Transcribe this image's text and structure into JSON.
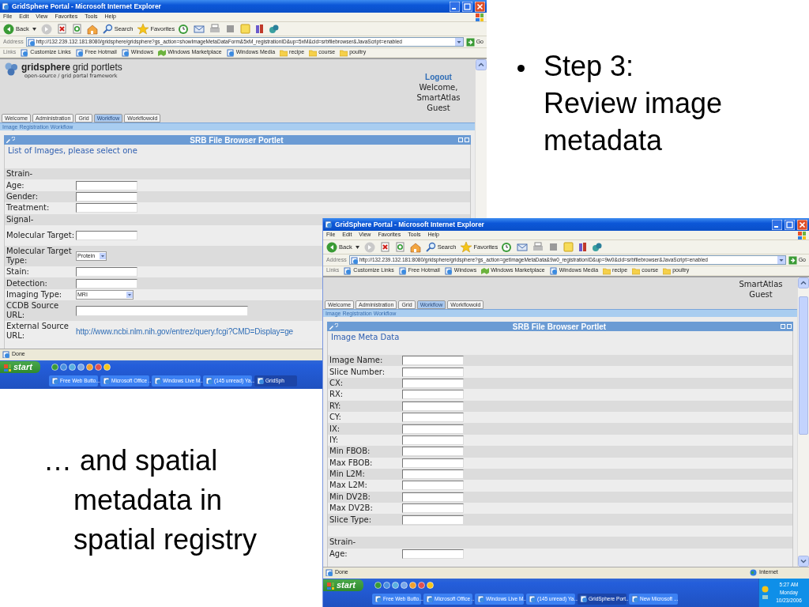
{
  "windows": [
    {
      "title": "GridSphere Portal - Microsoft Internet Explorer",
      "menu": [
        "File",
        "Edit",
        "View",
        "Favorites",
        "Tools",
        "Help"
      ],
      "toolbar": [
        "Back",
        "Search",
        "Favorites"
      ],
      "address_label": "Address",
      "url": "http://132.239.132.181:8080/gridsphere/gridsphere?gs_action=showImageMetaDataForm&5xM_registrationID&up=5xM&cid=srbfilebrowser&JavaScript=enabled",
      "go": "Go",
      "links_label": "Links",
      "links": [
        {
          "label": "Customize Links",
          "kind": "page"
        },
        {
          "label": "Free Hotmail",
          "kind": "page"
        },
        {
          "label": "Windows",
          "kind": "page"
        },
        {
          "label": "Windows Marketplace",
          "kind": "market"
        },
        {
          "label": "Windows Media",
          "kind": "page"
        },
        {
          "label": "recipe",
          "kind": "folder"
        },
        {
          "label": "course",
          "kind": "folder"
        },
        {
          "label": "poultry",
          "kind": "folder"
        }
      ],
      "header": {
        "logo_title": "gridsphere",
        "logo_rest": "grid portlets",
        "logo_subtitle": "open-source / grid portal framework",
        "logout": "Logout",
        "welcome": [
          "Welcome,",
          "SmartAtlas",
          "Guest"
        ]
      },
      "tabs": [
        {
          "label": "Welcome",
          "selected": false
        },
        {
          "label": "Administration",
          "selected": false
        },
        {
          "label": "Grid",
          "selected": false
        },
        {
          "label": "Workflow",
          "selected": true
        },
        {
          "label": "Workflowold",
          "selected": false
        }
      ],
      "breadcrumb": "Image Registration Workflow",
      "portlet_title": "SRB File Browser Portlet",
      "section_title": "List of Images, please select one",
      "rows": [
        {
          "kind": "section",
          "label": "Strain-"
        },
        {
          "kind": "text",
          "label": "Age:"
        },
        {
          "kind": "text",
          "label": "Gender:"
        },
        {
          "kind": "text",
          "label": "Treatment:"
        },
        {
          "kind": "section",
          "label": "Signal-"
        },
        {
          "kind": "text",
          "label": "Molecular Target:"
        },
        {
          "kind": "select",
          "label": "Molecular Target Type:",
          "value": "Protein"
        },
        {
          "kind": "text",
          "label": "Stain:"
        },
        {
          "kind": "text",
          "label": "Detection:"
        },
        {
          "kind": "select",
          "label": "Imaging Type:",
          "value": "MRI"
        },
        {
          "kind": "wide",
          "label": "CCDB Source URL:"
        },
        {
          "kind": "link",
          "label": "External Source URL:",
          "value": "http://www.ncbi.nlm.nih.gov/entrez/query.fcgi?CMD=Display=ge"
        }
      ],
      "status": "Done",
      "start": "start",
      "tasks": [
        {
          "label": "Free Web Butto...",
          "selected": false
        },
        {
          "label": "Microsoft Office ...",
          "selected": false
        },
        {
          "label": "Windows Live M...",
          "selected": false
        },
        {
          "label": "(145 unread) Ya...",
          "selected": false
        },
        {
          "label": "GridSph",
          "selected": true
        }
      ]
    },
    {
      "title": "GridSphere Portal - Microsoft Internet Explorer",
      "menu": [
        "File",
        "Edit",
        "View",
        "Favorites",
        "Tools",
        "Help"
      ],
      "toolbar": [
        "Back",
        "Search",
        "Favorites"
      ],
      "address_label": "Address",
      "url": "http://132.239.132.181:8080/gridsphere/gridsphere?gs_action=getImageMetaData&9w0_registrationID&up=9w0&cid=srbfilebrowser&JavaScript=enabled",
      "go": "Go",
      "links_label": "Links",
      "links": [
        {
          "label": "Customize Links",
          "kind": "page"
        },
        {
          "label": "Free Hotmail",
          "kind": "page"
        },
        {
          "label": "Windows",
          "kind": "page"
        },
        {
          "label": "Windows Marketplace",
          "kind": "market"
        },
        {
          "label": "Windows Media",
          "kind": "page"
        },
        {
          "label": "recipe",
          "kind": "folder"
        },
        {
          "label": "course",
          "kind": "folder"
        },
        {
          "label": "poultry",
          "kind": "folder"
        }
      ],
      "header": {
        "welcome": [
          "SmartAtlas",
          "Guest"
        ]
      },
      "tabs": [
        {
          "label": "Welcome",
          "selected": false
        },
        {
          "label": "Administration",
          "selected": false
        },
        {
          "label": "Grid",
          "selected": false
        },
        {
          "label": "Workflow",
          "selected": true
        },
        {
          "label": "Workflowold",
          "selected": false
        }
      ],
      "breadcrumb": "Image Registration Workflow",
      "portlet_title": "SRB File Browser Portlet",
      "section_title": "Image Meta Data",
      "rows": [
        {
          "kind": "text",
          "label": "Image Name:"
        },
        {
          "kind": "text",
          "label": "Slice Number:"
        },
        {
          "kind": "text",
          "label": "CX:"
        },
        {
          "kind": "text",
          "label": "RX:"
        },
        {
          "kind": "text",
          "label": "RY:"
        },
        {
          "kind": "text",
          "label": "CY:"
        },
        {
          "kind": "text",
          "label": "IX:"
        },
        {
          "kind": "text",
          "label": "IY:"
        },
        {
          "kind": "text",
          "label": "Min FBOB:"
        },
        {
          "kind": "text",
          "label": "Max FBOB:"
        },
        {
          "kind": "text",
          "label": "Min L2M:"
        },
        {
          "kind": "text",
          "label": "Max L2M:"
        },
        {
          "kind": "text",
          "label": "Min DV2B:"
        },
        {
          "kind": "text",
          "label": "Max DV2B:"
        },
        {
          "kind": "text",
          "label": "Slice Type:"
        },
        {
          "kind": "spacer"
        },
        {
          "kind": "section",
          "label": "Strain-"
        },
        {
          "kind": "text",
          "label": "Age:"
        }
      ],
      "status": "Done",
      "zone": "Internet",
      "start": "start",
      "tasks": [
        {
          "label": "Free Web Butto...",
          "selected": false
        },
        {
          "label": "Microsoft Office ...",
          "selected": false
        },
        {
          "label": "Windows Live M...",
          "selected": false
        },
        {
          "label": "(145 unread) Ya...",
          "selected": false
        },
        {
          "label": "GridSphere Port...",
          "selected": true
        },
        {
          "label": "New Microsoft ...",
          "selected": false
        }
      ],
      "clock": [
        "5:27 AM",
        "Monday",
        "10/23/2006"
      ]
    }
  ],
  "bullet_text": "Step 3: Review image metadata",
  "note_text": "… and spatial metadata in spatial registry"
}
